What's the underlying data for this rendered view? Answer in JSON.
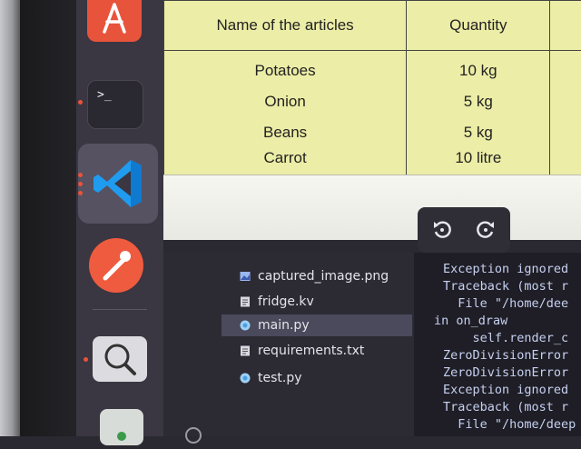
{
  "document": {
    "headers": [
      "Name of the articles",
      "Quantity"
    ],
    "rows": [
      {
        "name": "Potatoes",
        "quantity": "10 kg"
      },
      {
        "name": "Onion",
        "quantity": "5 kg"
      },
      {
        "name": "Beans",
        "quantity": "5 kg"
      },
      {
        "name": "Carrot",
        "quantity": "10 litre"
      }
    ]
  },
  "dock": {
    "apps": [
      "app-center",
      "terminal",
      "vscode",
      "postman",
      "image-viewer-search",
      "app"
    ]
  },
  "explorer": {
    "files": [
      {
        "name": "captured_image.png",
        "icon": "image-icon"
      },
      {
        "name": "fridge.kv",
        "icon": "text-file-icon"
      },
      {
        "name": "main.py",
        "icon": "python-icon",
        "selected": true
      },
      {
        "name": "requirements.txt",
        "icon": "text-file-icon"
      },
      {
        "name": "test.py",
        "icon": "python-icon"
      }
    ]
  },
  "terminal": {
    "lines": [
      "Exception ignored",
      "Traceback (most r",
      "  File \"/home/dee",
      "in on_draw",
      "    self.render_c",
      "ZeroDivisionError",
      "ZeroDivisionError",
      "Exception ignored",
      "Traceback (most r",
      "  File \"/home/deep"
    ]
  },
  "colors": {
    "accent_orange": "#e8533c",
    "vscode_blue": "#1f9cf0",
    "selection": "#4a4a5c",
    "terminal_text": "#c6d0f0"
  }
}
